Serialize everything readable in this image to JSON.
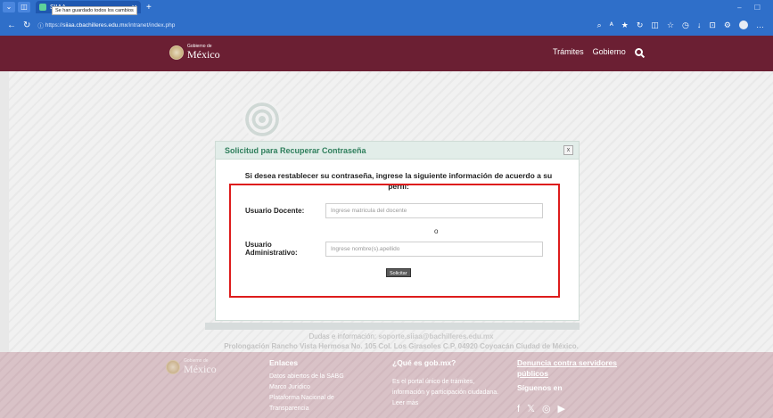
{
  "browser": {
    "tab_title": "SIIAA",
    "tooltip": "Se han guardado todos los cambios",
    "url_prefix": "https://",
    "url_host": "siiaa.cbachilleres.edu.mx",
    "url_path": "/intranet/index.php"
  },
  "header": {
    "logo_small": "Gobierno de",
    "logo_big": "México",
    "nav": [
      "Trámites",
      "Gobierno"
    ]
  },
  "dialog": {
    "title": "Solicitud para Recuperar Contraseña",
    "close_label": "x",
    "intro": "Si desea restablecer su contraseña, ingrese la siguiente información de acuerdo a su perfil:",
    "docente_label": "Usuario Docente:",
    "docente_placeholder": "Ingrese matricula del docente",
    "or_label": "o",
    "admin_label_1": "Usuario",
    "admin_label_2": "Administrativo:",
    "admin_placeholder": "Ingrese nombre(s).apellido",
    "submit_label": "Solicitar"
  },
  "contact": {
    "line1_prefix": "Dudas e información:",
    "email": "soporte.siiaa@bachilleres.edu.mx",
    "address": "Prolongación Rancho Vista Hermosa No. 105 Col. Los Girasoles C.P. 04920 Coyoacán Ciudad de México."
  },
  "footer": {
    "logo_small": "Gobierno de",
    "logo_big": "México",
    "enlaces_title": "Enlaces",
    "enlaces": [
      "Datos abiertos de la SABG",
      "Marco Jurídico",
      "Plataforma Nacional de Transparencia"
    ],
    "que_es_title": "¿Qué es gob.mx?",
    "que_es_text": "Es el portal único de trámites, información y participación ciudadana. Leer más",
    "denuncia_title": "Denuncia contra servidores públicos",
    "siguenos_title": "Síguenos en"
  },
  "colors": {
    "header_bg": "#6b1f33",
    "accent_green": "#2f7f5c",
    "highlight_red": "#dd1c1c"
  }
}
